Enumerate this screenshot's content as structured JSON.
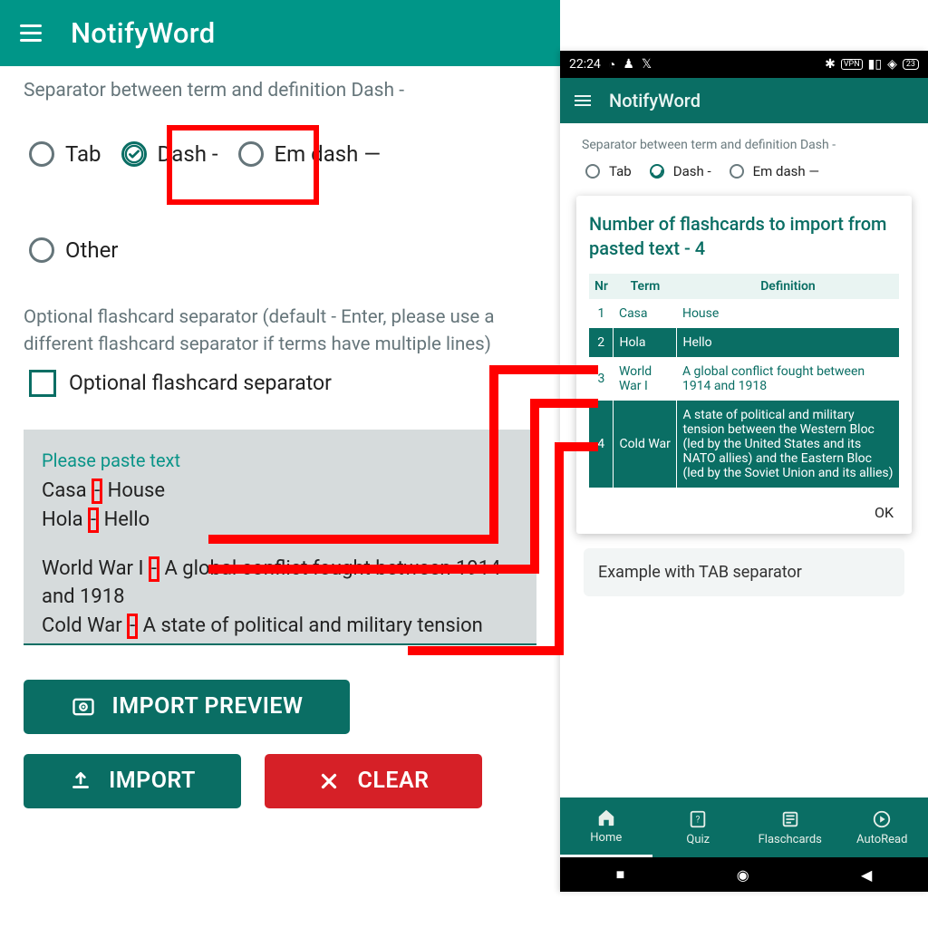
{
  "left": {
    "app_title": "NotifyWord",
    "separator_label": "Separator between term and definition Dash -",
    "radio_tab": "Tab",
    "radio_dash": "Dash -",
    "radio_emdash": "Em dash —",
    "radio_other": "Other",
    "optional_help": "Optional flashcard separator (default - Enter, please use a different flashcard separator if terms have multiple lines)",
    "checkbox_label": "Optional flashcard separator",
    "paste_placeholder": "Please paste text",
    "paste_lines": {
      "l1a": "Casa ",
      "l1b": "-",
      "l1c": " House",
      "l2a": "Hola ",
      "l2b": "-",
      "l2c": " Hello",
      "l3a": "World War I ",
      "l3b": "-",
      "l3c": " A global conflict fought between 1914 and 1918",
      "l4a": "Cold War ",
      "l4b": "-",
      "l4c": " A state of political and military tension between the"
    },
    "btn_preview": "IMPORT PREVIEW",
    "btn_import": "IMPORT",
    "btn_clear": "CLEAR"
  },
  "phone": {
    "status_time": "22:24",
    "app_title": "NotifyWord",
    "separator_label": "Separator between term and definition Dash -",
    "radio_tab": "Tab",
    "radio_dash": "Dash -",
    "radio_emdash": "Em dash —",
    "dialog_title": "Number of flashcards to import from pasted text - 4",
    "th_nr": "Nr",
    "th_term": "Term",
    "th_def": "Definition",
    "rows": [
      {
        "nr": "1",
        "term": "Casa",
        "def": "House"
      },
      {
        "nr": "2",
        "term": "Hola",
        "def": "Hello"
      },
      {
        "nr": "3",
        "term": "World War I",
        "def": "A global conflict fought between 1914 and 1918"
      },
      {
        "nr": "4",
        "term": "Cold War",
        "def": "A state of political and military tension between the Western Bloc (led by the United States and its NATO allies) and the Eastern Bloc (led by the Soviet Union and its allies)"
      }
    ],
    "dialog_ok": "OK",
    "example_title": "Example with TAB separator",
    "nav_home": "Home",
    "nav_quiz": "Quiz",
    "nav_flash": "Flaschcards",
    "nav_auto": "AutoRead"
  }
}
